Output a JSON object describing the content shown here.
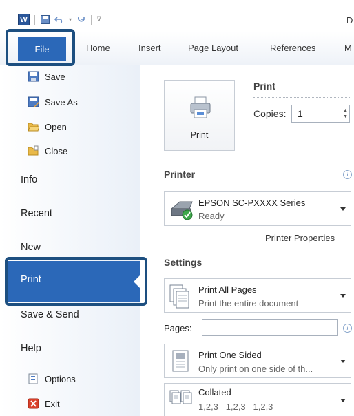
{
  "window": {
    "title_partial": "D"
  },
  "ribbon": {
    "file_label": "File",
    "tabs": [
      "Home",
      "Insert",
      "Page Layout",
      "References",
      "M"
    ]
  },
  "backstage": {
    "commands": [
      {
        "label": "Save",
        "icon": "save-icon"
      },
      {
        "label": "Save As",
        "icon": "save-as-icon"
      },
      {
        "label": "Open",
        "icon": "open-folder-icon"
      },
      {
        "label": "Close",
        "icon": "close-folder-icon"
      }
    ],
    "nav": [
      "Info",
      "Recent",
      "New",
      "Print",
      "Save & Send",
      "Help"
    ],
    "selected": "Print",
    "bottom": [
      {
        "label": "Options",
        "icon": "options-icon"
      },
      {
        "label": "Exit",
        "icon": "exit-icon"
      }
    ]
  },
  "print": {
    "heading": "Print",
    "button_label": "Print",
    "copies_label": "Copies:",
    "copies_value": "1",
    "printer_heading": "Printer",
    "printer_name": "EPSON SC-PXXXX Series",
    "printer_status": "Ready",
    "printer_properties": "Printer Properties",
    "settings_heading": "Settings",
    "settings": [
      {
        "title": "Print All Pages",
        "subtitle": "Print the entire document",
        "icon": "pages-icon"
      },
      {
        "title": "Print One Sided",
        "subtitle": "Only print on one side of th...",
        "icon": "one-sided-icon"
      },
      {
        "title": "Collated",
        "subtitle": "1,2,3   1,2,3   1,2,3",
        "icon": "collated-icon"
      }
    ],
    "pages_label": "Pages:",
    "pages_value": ""
  },
  "colors": {
    "accent": "#2b68b8",
    "callout": "#1d4f80"
  }
}
